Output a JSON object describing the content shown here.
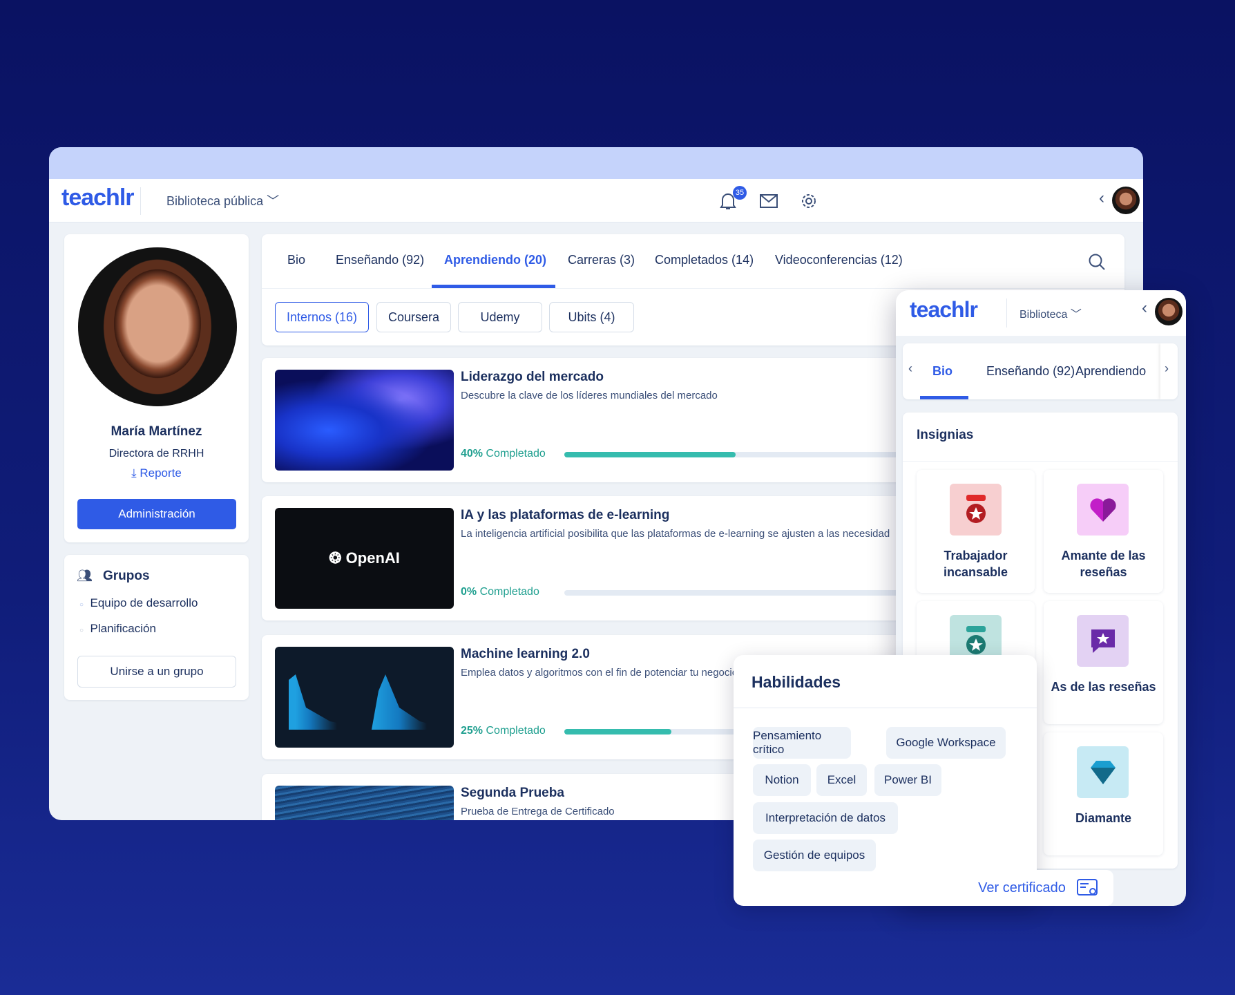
{
  "header": {
    "logo": "teachlr",
    "library": "Biblioteca pública",
    "notifications": "35",
    "icons": [
      "bell-icon",
      "mail-icon",
      "gear-icon",
      "chevron-left-icon"
    ]
  },
  "profile": {
    "name": "María Martínez",
    "role": "Directora de RRHH",
    "report": "Reporte",
    "admin_button": "Administración"
  },
  "groups": {
    "title": "Grupos",
    "items": [
      "Equipo de desarrollo",
      "Planificación"
    ],
    "join_button": "Unirse a un grupo"
  },
  "tabs": [
    "Bio",
    "Enseñando (92)",
    "Aprendiendo (20)",
    "Carreras (3)",
    "Completados (14)",
    "Videoconferencias (12)"
  ],
  "active_tab": "Aprendiendo (20)",
  "subtabs": [
    "Internos (16)",
    "Coursera",
    "Udemy",
    "Ubits (4)"
  ],
  "courses": [
    {
      "title": "Liderazgo del mercado",
      "desc": "Descubre la clave de los líderes mundiales del mercado",
      "pct": "40%",
      "label": "Completado",
      "progress": 40
    },
    {
      "title": "IA y las plataformas de e-learning",
      "desc": "La inteligencia artificial posibilita que las plataformas de e-learning se ajusten a las necesidad",
      "pct": "0%",
      "label": "Completado",
      "progress": 0,
      "thumb_text": "OpenAI"
    },
    {
      "title": "Machine learning 2.0",
      "desc": "Emplea datos y algoritmos con el fin de potenciar tu negocio",
      "pct": "25%",
      "label": "Completado",
      "progress": 25
    },
    {
      "title": "Segunda Prueba",
      "desc": "Prueba de Entrega de Certificado"
    }
  ],
  "mobile": {
    "logo": "teachlr",
    "library": "Biblioteca",
    "tabs": [
      "Bio",
      "Enseñando (92)",
      "Aprendiendo"
    ],
    "badges_title": "Insignias",
    "badges": [
      {
        "label": "Trabajador incansable",
        "icon": "medal-icon",
        "bg": "#f7cfd0"
      },
      {
        "label": "Amante de las reseñas",
        "icon": "heart-icon",
        "bg": "#f6cdf8"
      },
      {
        "label": "",
        "icon": "medal-icon",
        "bg": "#bfe3e0"
      },
      {
        "label": "As de las reseñas",
        "icon": "star-chat-icon",
        "bg": "#e3d2f3"
      },
      {
        "label": "Diamante",
        "icon": "diamond-icon",
        "bg": "#c7eaf4"
      }
    ]
  },
  "skills": {
    "title": "Habilidades",
    "items": [
      "Pensamiento crítico",
      "Google Workspace",
      "Notion",
      "Excel",
      "Power BI",
      "Interpretación de datos",
      "Gestión de equipos"
    ]
  },
  "certificate": {
    "label": "Ver certificado"
  },
  "colors": {
    "accent": "#2f5be6",
    "progress": "#35bcae",
    "text": "#1b2f5e"
  }
}
